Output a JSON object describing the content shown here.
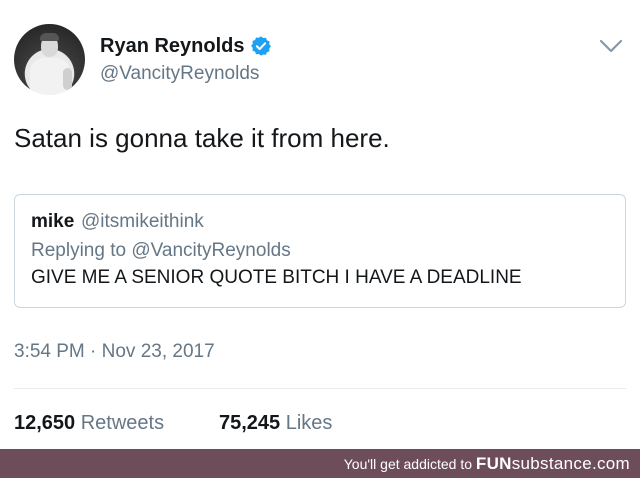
{
  "tweet": {
    "author": {
      "display_name": "Ryan Reynolds",
      "handle": "@VancityReynolds",
      "verified": true
    },
    "text": "Satan is gonna take it from here.",
    "quoted": {
      "name": "mike",
      "handle": "@itsmikeithink",
      "replying_to": "Replying to @VancityReynolds",
      "text": "GIVE ME A SENIOR QUOTE BITCH I HAVE A DEADLINE"
    },
    "timestamp": "3:54 PM · Nov 23, 2017",
    "stats": {
      "retweets_count": "12,650",
      "retweets_label": "Retweets",
      "likes_count": "75,245",
      "likes_label": "Likes"
    }
  },
  "footer": {
    "prefix": "You'll get addicted to",
    "brand_fun": "FUN",
    "brand_rest": "substance.com"
  },
  "colors": {
    "verified": "#1da1f2",
    "secondary_text": "#657786",
    "footer_bg": "#6e4d5b"
  },
  "icons": {
    "verified": "verified-badge-icon",
    "more": "chevron-down-icon"
  }
}
